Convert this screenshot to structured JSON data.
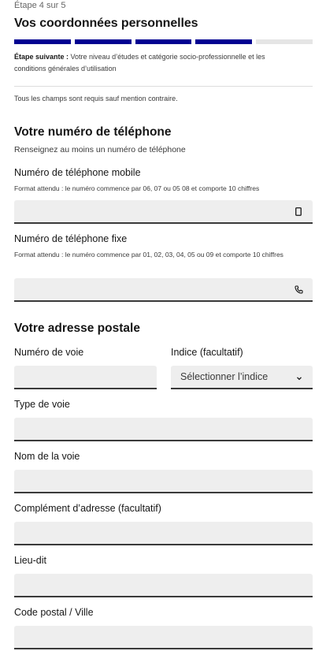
{
  "header": {
    "step_label": "Étape 4 sur 5",
    "title": "Vos coordonnées personnelles",
    "progress": {
      "current": 4,
      "total": 5
    },
    "next_step_label": "Étape suivante :",
    "next_step_text": " Votre niveau d’études et catégorie socio-professionnelle et les conditions générales d’utilisation",
    "required_note": "Tous les champs sont requis sauf mention contraire."
  },
  "phone": {
    "title": "Votre numéro de téléphone",
    "hint": "Renseignez au moins un numéro de téléphone",
    "mobile_label": "Numéro de téléphone mobile",
    "mobile_hint": "Format attendu : le numéro commence par 06, 07 ou 05 08 et comporte 10 chiffres",
    "mobile_value": "",
    "fixe_label": "Numéro de téléphone fixe",
    "fixe_hint": "Format attendu : le numéro commence par 01, 02, 03, 04, 05 ou 09 et comporte 10 chiffres",
    "fixe_value": ""
  },
  "address": {
    "title": "Votre adresse postale",
    "numero_label": "Numéro de voie",
    "numero_value": "",
    "indice_label": "Indice (facultatif)",
    "indice_selected": "Sélectionner l’indice",
    "type_label": "Type de voie",
    "type_value": "",
    "nom_label": "Nom de la voie",
    "nom_value": "",
    "complement_label": "Complément d’adresse (facultatif)",
    "complement_value": "",
    "lieu_label": "Lieu-dit",
    "lieu_value": "",
    "cp_label": "Code postal / Ville",
    "cp_value": ""
  },
  "colors": {
    "accent": "#000091",
    "progress_todo": "#e5e5e5",
    "input_bg": "#eeeeee",
    "input_border": "#3a3a3a"
  },
  "icons": {
    "mobile": "mobile-phone-icon",
    "fixe": "landline-phone-icon",
    "select": "chevron-down-icon"
  }
}
